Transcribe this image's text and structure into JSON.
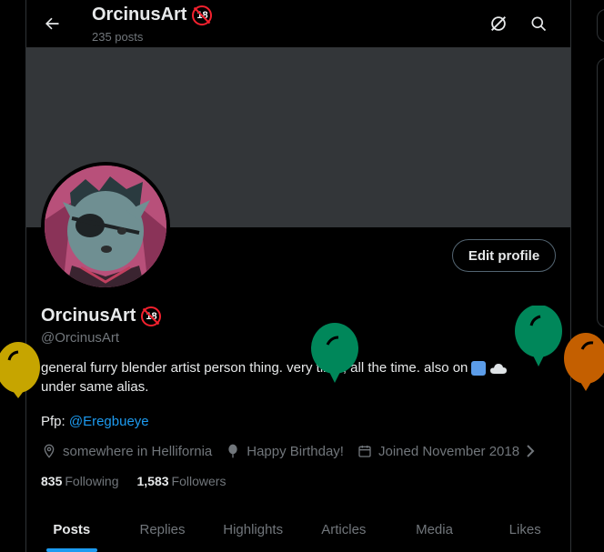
{
  "header": {
    "title": "OrcinusArt",
    "post_count": "235 posts",
    "badge": "18"
  },
  "profile": {
    "name": "OrcinusArt",
    "badge": "18",
    "handle": "@OrcinusArt",
    "edit_label": "Edit profile",
    "bio_line1": "general furry blender artist person thing. very tired, all the time. also on",
    "bio_line2": "under same alias.",
    "pfp_prefix": "Pfp:",
    "pfp_link": "@Eregbueye",
    "location": "somewhere in Hellifornia",
    "birthday": "Happy Birthday!",
    "joined": "Joined November 2018"
  },
  "stats": {
    "following_count": "835",
    "following_label": "Following",
    "followers_count": "1,583",
    "followers_label": "Followers"
  },
  "tabs": [
    "Posts",
    "Replies",
    "Highlights",
    "Articles",
    "Media",
    "Likes"
  ],
  "colors": {
    "accent": "#1d9bf0",
    "banner": "#333639",
    "balloon_yellow": "#c6a500",
    "balloon_green": "#00875a",
    "balloon_orange": "#c45f00"
  }
}
